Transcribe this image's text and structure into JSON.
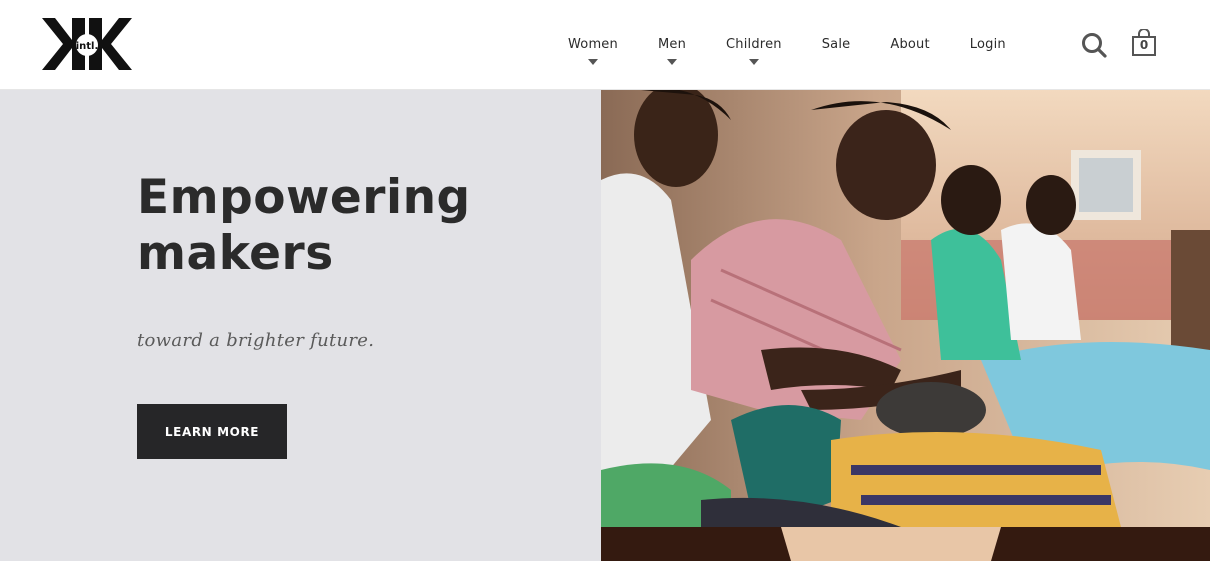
{
  "header": {
    "logo": {
      "alt": "intl.",
      "mark_text": "intl."
    },
    "nav": [
      {
        "label": "Women",
        "has_dropdown": true
      },
      {
        "label": "Men",
        "has_dropdown": true
      },
      {
        "label": "Children",
        "has_dropdown": true
      },
      {
        "label": "Sale",
        "has_dropdown": false
      },
      {
        "label": "About",
        "has_dropdown": false
      },
      {
        "label": "Login",
        "has_dropdown": false
      }
    ],
    "search_icon": "search-icon",
    "cart": {
      "icon": "shopping-bag-icon",
      "count": "0"
    }
  },
  "hero": {
    "title_line1": "Empowering",
    "title_line2": "makers",
    "subtitle": "toward a brighter future.",
    "cta_label": "LEARN MORE",
    "image_alt": "Women knitting together outdoors"
  },
  "colors": {
    "hero_bg": "#e2e2e6",
    "button_bg": "#262628",
    "text_dark": "#2b2b2b"
  }
}
